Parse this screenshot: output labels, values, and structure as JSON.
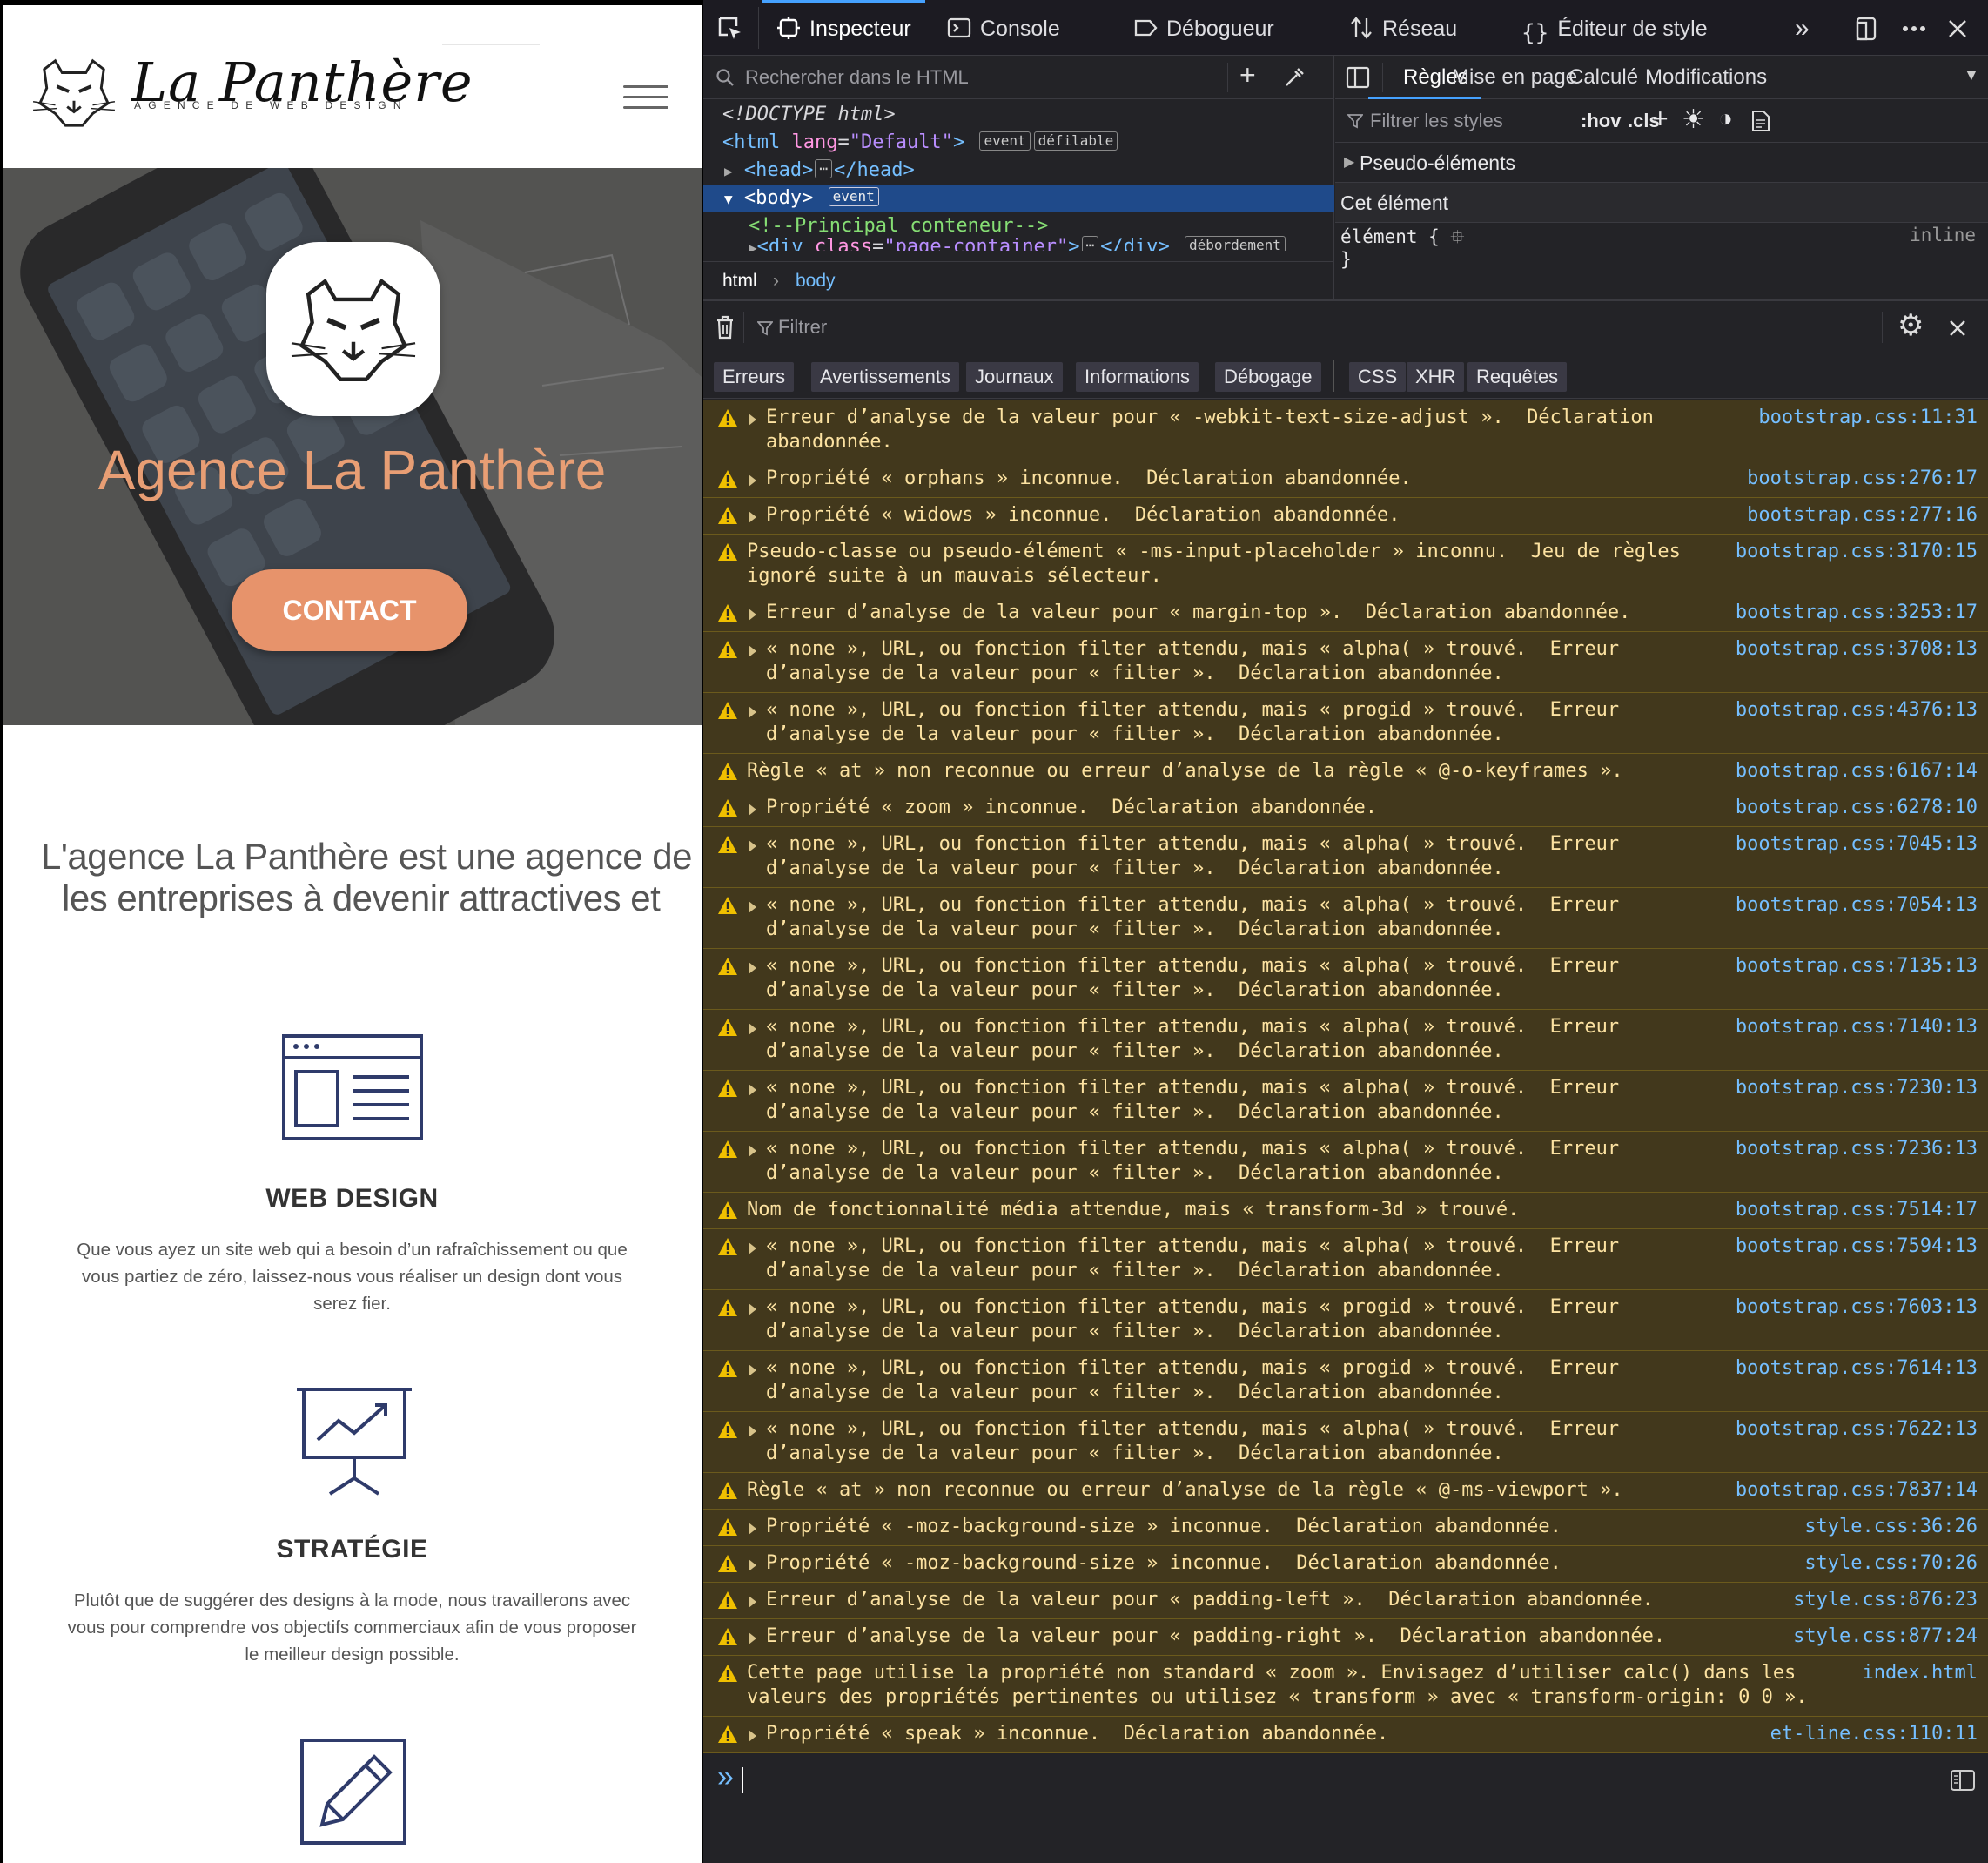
{
  "site": {
    "brand": "La Panthère",
    "tagline": "AGENCE DE WEB DESIGN",
    "hero_title": "Agence La Panthère",
    "contact_label": "CONTACT",
    "intro_line1": "L'agence La Panthère est une agence de",
    "intro_line2": "les entreprises à devenir attractives et",
    "services": [
      {
        "title": "WEB DESIGN",
        "description_lines": [
          "Que vous ayez un site web qui a besoin d’un rafraîchissement ou que",
          "vous partiez de zéro, laissez-nous vous réaliser un design dont vous",
          "serez fier."
        ],
        "icon": "browser-layout-icon"
      },
      {
        "title": "STRATÉGIE",
        "description_lines": [
          "Plutôt que de suggérer des designs à la mode, nous travaillerons avec",
          "vous pour comprendre vos objectifs commerciaux afin de vous proposer",
          "le meilleur design possible."
        ],
        "icon": "presentation-chart-icon"
      },
      {
        "icon": "pencil-edit-icon"
      }
    ],
    "colors": {
      "accent": "#e7936b",
      "hero_title": "#e89e74",
      "text": "#555555"
    }
  },
  "devtools": {
    "tabs": [
      "Inspecteur",
      "Console",
      "Débogueur",
      "Réseau",
      "Éditeur de style"
    ],
    "active_tab": "Inspecteur",
    "html_search_placeholder": "Rechercher dans le HTML",
    "markup": {
      "doctype": "<!DOCTYPE html>",
      "html_tag": "html",
      "html_attr": "lang",
      "html_attr_val": "\"Default\"",
      "badge_event": "event",
      "badge_scroll": "défilable",
      "head": "head",
      "body": "body",
      "comment": "<!--Principal conteneur-->",
      "div_tag": "div",
      "div_attr": "class",
      "div_attr_val": "\"page-container\"",
      "badge_overflow": "débordement"
    },
    "breadcrumb": [
      "html",
      "body"
    ],
    "rules_tabs": [
      "Règles",
      "Mise en page",
      "Calculé",
      "Modifications"
    ],
    "active_rules_tab": "Règles",
    "rules_filter_placeholder": "Filtrer les styles",
    "hov": ":hov",
    "cls": ".cls",
    "pseudo_elements": "Pseudo-éléments",
    "this_element": "Cet élément",
    "element_rule": "élément {",
    "rule_close": "}",
    "inline": "inline",
    "console": {
      "filter_placeholder": "Filtrer",
      "categories": [
        "Erreurs",
        "Avertissements",
        "Journaux",
        "Informations",
        "Débogage",
        "CSS",
        "XHR",
        "Requêtes"
      ],
      "messages": [
        {
          "lines": [
            "Erreur d’analyse de la valeur pour « -webkit-text-size-adjust ».  Déclaration",
            "abandonnée."
          ],
          "source": "bootstrap.css:11:31",
          "expandable": true
        },
        {
          "lines": [
            "Propriété « orphans » inconnue.  Déclaration abandonnée."
          ],
          "source": "bootstrap.css:276:17",
          "expandable": true
        },
        {
          "lines": [
            "Propriété « widows » inconnue.  Déclaration abandonnée."
          ],
          "source": "bootstrap.css:277:16",
          "expandable": true
        },
        {
          "lines": [
            "Pseudo-classe ou pseudo-élément « -ms-input-placeholder » inconnu.  Jeu de règles",
            "ignoré suite à un mauvais sélecteur."
          ],
          "source": "bootstrap.css:3170:15",
          "expandable": false
        },
        {
          "lines": [
            "Erreur d’analyse de la valeur pour « margin-top ».  Déclaration abandonnée."
          ],
          "source": "bootstrap.css:3253:17",
          "expandable": true
        },
        {
          "lines": [
            "« none », URL, ou fonction filter attendu, mais « alpha( » trouvé.  Erreur",
            "d’analyse de la valeur pour « filter ».  Déclaration abandonnée."
          ],
          "source": "bootstrap.css:3708:13",
          "expandable": true
        },
        {
          "lines": [
            "« none », URL, ou fonction filter attendu, mais « progid » trouvé.  Erreur",
            "d’analyse de la valeur pour « filter ».  Déclaration abandonnée."
          ],
          "source": "bootstrap.css:4376:13",
          "expandable": true
        },
        {
          "lines": [
            "Règle « at » non reconnue ou erreur d’analyse de la règle « @-o-keyframes »."
          ],
          "source": "bootstrap.css:6167:14",
          "expandable": false
        },
        {
          "lines": [
            "Propriété « zoom » inconnue.  Déclaration abandonnée."
          ],
          "source": "bootstrap.css:6278:10",
          "expandable": true
        },
        {
          "lines": [
            "« none », URL, ou fonction filter attendu, mais « alpha( » trouvé.  Erreur",
            "d’analyse de la valeur pour « filter ».  Déclaration abandonnée."
          ],
          "source": "bootstrap.css:7045:13",
          "expandable": true
        },
        {
          "lines": [
            "« none », URL, ou fonction filter attendu, mais « alpha( » trouvé.  Erreur",
            "d’analyse de la valeur pour « filter ».  Déclaration abandonnée."
          ],
          "source": "bootstrap.css:7054:13",
          "expandable": true
        },
        {
          "lines": [
            "« none », URL, ou fonction filter attendu, mais « alpha( » trouvé.  Erreur",
            "d’analyse de la valeur pour « filter ».  Déclaration abandonnée."
          ],
          "source": "bootstrap.css:7135:13",
          "expandable": true
        },
        {
          "lines": [
            "« none », URL, ou fonction filter attendu, mais « alpha( » trouvé.  Erreur",
            "d’analyse de la valeur pour « filter ».  Déclaration abandonnée."
          ],
          "source": "bootstrap.css:7140:13",
          "expandable": true
        },
        {
          "lines": [
            "« none », URL, ou fonction filter attendu, mais « alpha( » trouvé.  Erreur",
            "d’analyse de la valeur pour « filter ».  Déclaration abandonnée."
          ],
          "source": "bootstrap.css:7230:13",
          "expandable": true
        },
        {
          "lines": [
            "« none », URL, ou fonction filter attendu, mais « alpha( » trouvé.  Erreur",
            "d’analyse de la valeur pour « filter ».  Déclaration abandonnée."
          ],
          "source": "bootstrap.css:7236:13",
          "expandable": true
        },
        {
          "lines": [
            "Nom de fonctionnalité média attendue, mais « transform-3d » trouvé."
          ],
          "source": "bootstrap.css:7514:17",
          "expandable": false
        },
        {
          "lines": [
            "« none », URL, ou fonction filter attendu, mais « alpha( » trouvé.  Erreur",
            "d’analyse de la valeur pour « filter ».  Déclaration abandonnée."
          ],
          "source": "bootstrap.css:7594:13",
          "expandable": true
        },
        {
          "lines": [
            "« none », URL, ou fonction filter attendu, mais « progid » trouvé.  Erreur",
            "d’analyse de la valeur pour « filter ».  Déclaration abandonnée."
          ],
          "source": "bootstrap.css:7603:13",
          "expandable": true
        },
        {
          "lines": [
            "« none », URL, ou fonction filter attendu, mais « progid » trouvé.  Erreur",
            "d’analyse de la valeur pour « filter ».  Déclaration abandonnée."
          ],
          "source": "bootstrap.css:7614:13",
          "expandable": true
        },
        {
          "lines": [
            "« none », URL, ou fonction filter attendu, mais « alpha( » trouvé.  Erreur",
            "d’analyse de la valeur pour « filter ».  Déclaration abandonnée."
          ],
          "source": "bootstrap.css:7622:13",
          "expandable": true
        },
        {
          "lines": [
            "Règle « at » non reconnue ou erreur d’analyse de la règle « @-ms-viewport »."
          ],
          "source": "bootstrap.css:7837:14",
          "expandable": false
        },
        {
          "lines": [
            "Propriété « -moz-background-size » inconnue.  Déclaration abandonnée."
          ],
          "source": "style.css:36:26",
          "expandable": true
        },
        {
          "lines": [
            "Propriété « -moz-background-size » inconnue.  Déclaration abandonnée."
          ],
          "source": "style.css:70:26",
          "expandable": true
        },
        {
          "lines": [
            "Erreur d’analyse de la valeur pour « padding-left ».  Déclaration abandonnée."
          ],
          "source": "style.css:876:23",
          "expandable": true
        },
        {
          "lines": [
            "Erreur d’analyse de la valeur pour « padding-right ».  Déclaration abandonnée."
          ],
          "source": "style.css:877:24",
          "expandable": true
        },
        {
          "lines": [
            "Cette page utilise la propriété non standard « zoom ». Envisagez d’utiliser calc() dans les",
            "valeurs des propriétés pertinentes ou utilisez « transform » avec « transform-origin: 0 0 »."
          ],
          "source": "index.html",
          "expandable": false
        },
        {
          "lines": [
            "Propriété « speak » inconnue.  Déclaration abandonnée."
          ],
          "source": "et-line.css:110:11",
          "expandable": true
        }
      ],
      "prompt": "»"
    }
  }
}
